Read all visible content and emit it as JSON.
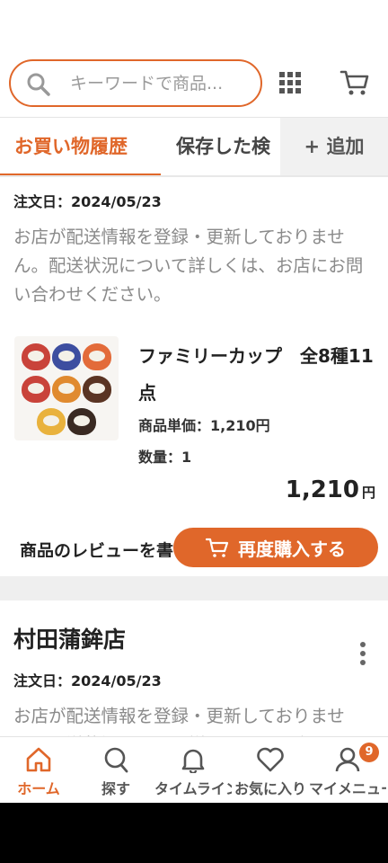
{
  "search": {
    "placeholder": "キーワードで商品..."
  },
  "header": {
    "grid_icon": "grid-icon",
    "cart_icon": "cart-icon"
  },
  "tabs": {
    "active": "お買い物履歴",
    "saved": "保存した検",
    "add": "+ 追加"
  },
  "orders": [
    {
      "date": "注文日：2024/05/23",
      "notice": "お店が配送情報を登録・更新しておりません。配送状況について詳しくは、お店にお問い合わせください。",
      "item": {
        "title": "ファミリーカップ　全8種11点",
        "unit_price": "商品単価：1,210円",
        "quantity": "数量：1",
        "total": "1,210",
        "total_unit": "円"
      },
      "review_label": "商品のレビューを書く",
      "rebuy_label": "再度購入する"
    },
    {
      "shop": "村田蒲鉾店",
      "date": "注文日：2024/05/23",
      "notice": "お店が配送情報を登録・更新しておりません。配送状況について詳しくは、お店にお問い合わせください。"
    }
  ],
  "nav": {
    "items": [
      {
        "label": "ホーム",
        "icon": "home-icon"
      },
      {
        "label": "探す",
        "icon": "search-icon"
      },
      {
        "label": "タイムライン",
        "icon": "bell-icon"
      },
      {
        "label": "お気に入り",
        "icon": "heart-icon"
      },
      {
        "label": "マイメニュー",
        "icon": "user-icon"
      }
    ],
    "badge_count": "9"
  },
  "colors": {
    "accent": "#e0672a"
  }
}
